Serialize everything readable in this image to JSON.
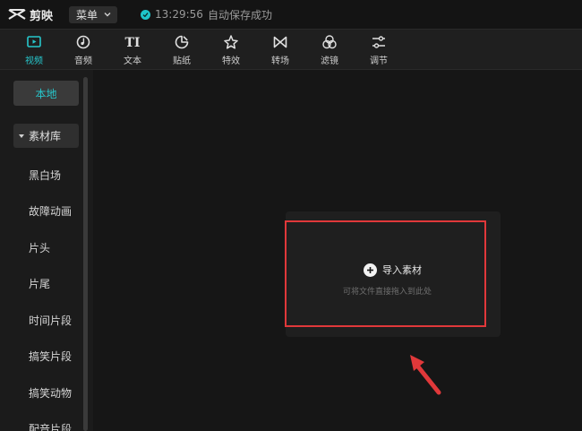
{
  "titlebar": {
    "app_name": "剪映",
    "menu_label": "菜单",
    "save_time": "13:29:56",
    "save_text": "自动保存成功"
  },
  "toolbar": {
    "tools": [
      {
        "label": "视频",
        "icon": "video-icon",
        "active": true
      },
      {
        "label": "音频",
        "icon": "audio-icon"
      },
      {
        "label": "文本",
        "icon": "text-icon"
      },
      {
        "label": "贴纸",
        "icon": "sticker-icon"
      },
      {
        "label": "特效",
        "icon": "effects-icon"
      },
      {
        "label": "转场",
        "icon": "transition-icon"
      },
      {
        "label": "滤镜",
        "icon": "filter-icon"
      },
      {
        "label": "调节",
        "icon": "adjust-icon"
      }
    ]
  },
  "sidebar": {
    "local_label": "本地",
    "library_label": "素材库",
    "items": [
      "黑白场",
      "故障动画",
      "片头",
      "片尾",
      "时间片段",
      "搞笑片段",
      "搞笑动物",
      "配音片段"
    ]
  },
  "main": {
    "import_label": "导入素材",
    "import_hint": "可将文件直接拖入到此处"
  },
  "colors": {
    "accent": "#27c7cc",
    "highlight": "#e0383a"
  }
}
